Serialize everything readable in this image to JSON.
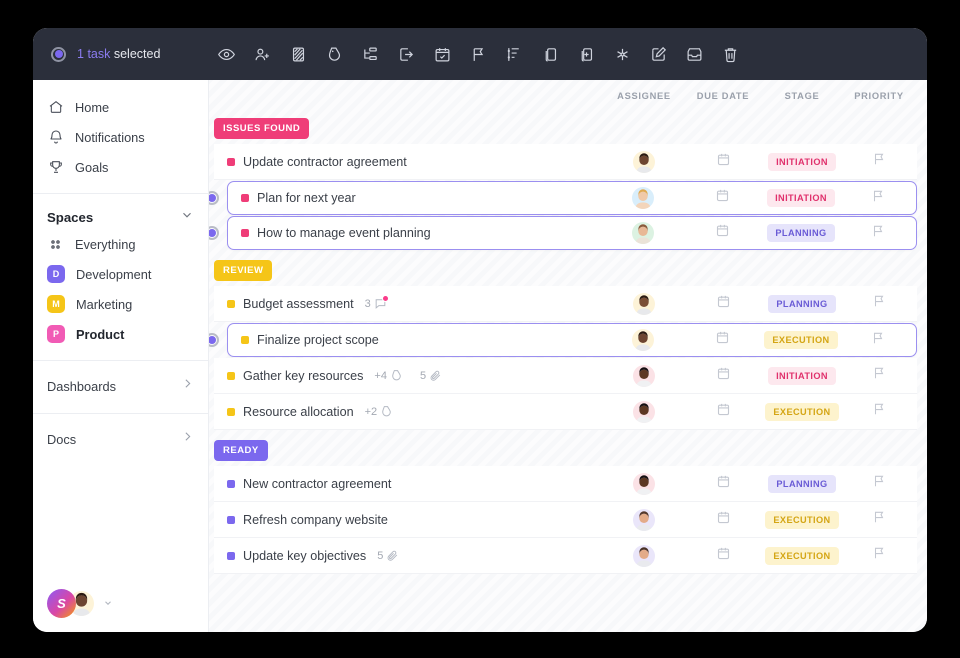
{
  "toolbar": {
    "selection_count": "1",
    "selection_word": "task",
    "selection_suffix": "selected",
    "actions": [
      {
        "name": "watch-icon",
        "label": "Watch"
      },
      {
        "name": "assign-user-icon",
        "label": "Assign"
      },
      {
        "name": "status-icon",
        "label": "Status"
      },
      {
        "name": "tag-icon",
        "label": "Tags"
      },
      {
        "name": "subtask-icon",
        "label": "Subtasks"
      },
      {
        "name": "move-icon",
        "label": "Move"
      },
      {
        "name": "calendar-icon",
        "label": "Due date"
      },
      {
        "name": "flag-icon",
        "label": "Priority"
      },
      {
        "name": "sort-icon",
        "label": "Sort"
      },
      {
        "name": "copy-icon",
        "label": "Copy"
      },
      {
        "name": "duplicate-icon",
        "label": "Duplicate"
      },
      {
        "name": "merge-icon",
        "label": "Merge"
      },
      {
        "name": "edit-icon",
        "label": "Edit"
      },
      {
        "name": "archive-icon",
        "label": "Archive"
      },
      {
        "name": "trash-icon",
        "label": "Delete"
      }
    ]
  },
  "sidebar": {
    "nav": [
      {
        "label": "Home",
        "icon": "home-icon"
      },
      {
        "label": "Notifications",
        "icon": "bell-icon"
      },
      {
        "label": "Goals",
        "icon": "trophy-icon"
      }
    ],
    "spaces_header": "Spaces",
    "everything_label": "Everything",
    "spaces": [
      {
        "label": "Development",
        "initial": "D",
        "color": "#7b68ee",
        "active": false
      },
      {
        "label": "Marketing",
        "initial": "M",
        "color": "#f5c518",
        "active": false
      },
      {
        "label": "Product",
        "initial": "P",
        "color": "#f15bb5",
        "active": true
      }
    ],
    "footer": [
      {
        "label": "Dashboards"
      },
      {
        "label": "Docs"
      }
    ],
    "user": {
      "initial": "S"
    }
  },
  "columns": {
    "assignee": "ASSIGNEE",
    "due_date": "DUE DATE",
    "stage": "STAGE",
    "priority": "PRIORITY"
  },
  "groups": [
    {
      "label": "ISSUES FOUND",
      "badge_color": "#ef3d78",
      "bullet_color": "#ef3d78",
      "tasks": [
        {
          "name": "Update contractor agreement",
          "selected": false,
          "stage": "INITIATION",
          "stage_class": "tag-initiation",
          "avatar_bg": "#fdf3d8",
          "avatar_skin": "#6d4531",
          "avatar_hair": "#2b1a12",
          "avatar_shirt": "#e8e9ec",
          "meta": []
        },
        {
          "name": "Plan for next year",
          "selected": true,
          "stage": "INITIATION",
          "stage_class": "tag-initiation",
          "avatar_bg": "#d9eefb",
          "avatar_skin": "#f0c9a8",
          "avatar_hair": "#e0a94f",
          "avatar_shirt": "#f3d5bb",
          "meta": []
        },
        {
          "name": "How to manage event planning",
          "selected": true,
          "stage": "PLANNING",
          "stage_class": "tag-planning",
          "avatar_bg": "#dcf2e2",
          "avatar_skin": "#e8b896",
          "avatar_hair": "#8a5a3b",
          "avatar_shirt": "#ebe3d8",
          "meta": []
        }
      ]
    },
    {
      "label": "REVIEW",
      "badge_color": "#f5c518",
      "bullet_color": "#f5c518",
      "tasks": [
        {
          "name": "Budget assessment",
          "selected": false,
          "stage": "PLANNING",
          "stage_class": "tag-planning",
          "avatar_bg": "#fdf3d8",
          "avatar_skin": "#7a4e36",
          "avatar_hair": "#2b1a12",
          "avatar_shirt": "#e8e9ec",
          "meta": [
            {
              "type": "comment",
              "value": "3",
              "alert": true
            }
          ]
        },
        {
          "name": "Finalize project scope",
          "selected": true,
          "stage": "EXECUTION",
          "stage_class": "tag-execution",
          "avatar_bg": "#fdf3d8",
          "avatar_skin": "#6d4531",
          "avatar_hair": "#2b1a12",
          "avatar_shirt": "#e8e9ec",
          "meta": []
        },
        {
          "name": "Gather key resources",
          "selected": false,
          "stage": "INITIATION",
          "stage_class": "tag-initiation",
          "avatar_bg": "#fbe2e6",
          "avatar_skin": "#5d3823",
          "avatar_hair": "#161012",
          "avatar_shirt": "#f0f1f3",
          "meta": [
            {
              "type": "tag",
              "value": "+4",
              "alert": false
            },
            {
              "type": "attachment",
              "value": "5",
              "alert": false
            }
          ]
        },
        {
          "name": "Resource allocation",
          "selected": false,
          "stage": "EXECUTION",
          "stage_class": "tag-execution",
          "avatar_bg": "#fbe2e6",
          "avatar_skin": "#5d3823",
          "avatar_hair": "#161012",
          "avatar_shirt": "#f0f1f3",
          "meta": [
            {
              "type": "tag",
              "value": "+2",
              "alert": false
            }
          ]
        }
      ]
    },
    {
      "label": "READY",
      "badge_color": "#7b68ee",
      "bullet_color": "#7b68ee",
      "tasks": [
        {
          "name": "New contractor agreement",
          "selected": false,
          "stage": "PLANNING",
          "stage_class": "tag-planning",
          "avatar_bg": "#fbe2e6",
          "avatar_skin": "#5d3823",
          "avatar_hair": "#161012",
          "avatar_shirt": "#f0f1f3",
          "meta": []
        },
        {
          "name": "Refresh company website",
          "selected": false,
          "stage": "EXECUTION",
          "stage_class": "tag-execution",
          "avatar_bg": "#eae6fa",
          "avatar_skin": "#e3ab88",
          "avatar_hair": "#55382a",
          "avatar_shirt": "#e9eaee",
          "meta": []
        },
        {
          "name": "Update key objectives",
          "selected": false,
          "stage": "EXECUTION",
          "stage_class": "tag-execution",
          "avatar_bg": "#eae6fa",
          "avatar_skin": "#e3ab88",
          "avatar_hair": "#4a3226",
          "avatar_shirt": "#e9eaee",
          "meta": [
            {
              "type": "attachment",
              "value": "5",
              "alert": false
            }
          ]
        }
      ]
    }
  ]
}
